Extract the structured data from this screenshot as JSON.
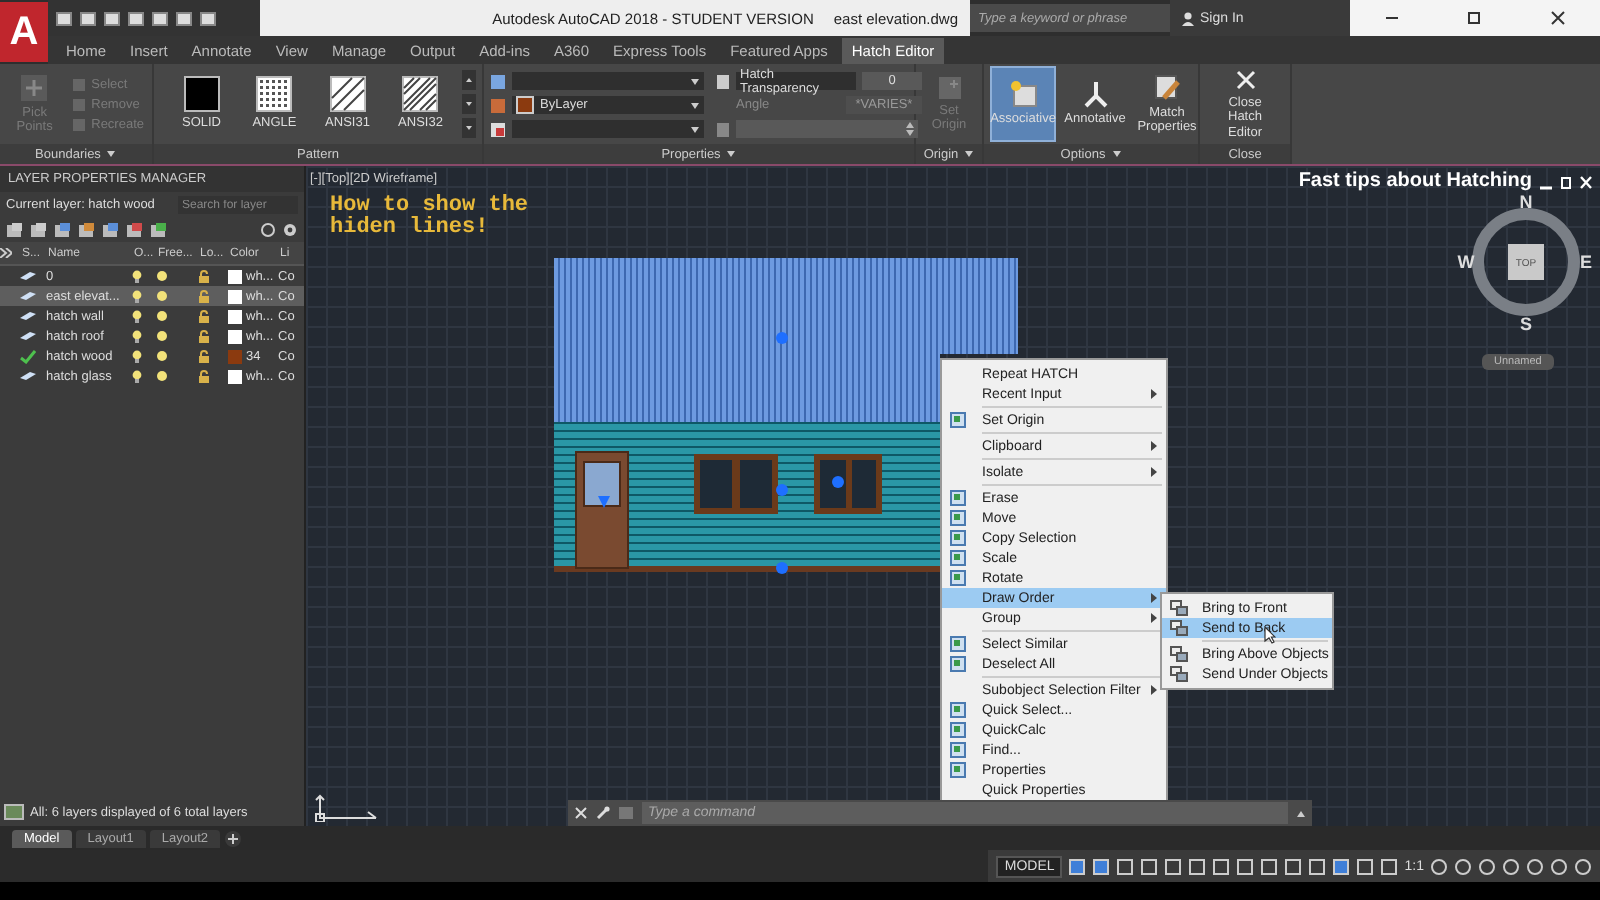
{
  "app_button": {
    "label": "A"
  },
  "title_bar": {
    "title": "Autodesk AutoCAD 2018 - STUDENT VERSION",
    "file": "east elevation.dwg",
    "search": {
      "placeholder": "Type a keyword or phrase"
    },
    "sign_in": "Sign In"
  },
  "ribbon_tabs": [
    {
      "label": "Home",
      "selected": false
    },
    {
      "label": "Insert",
      "selected": false
    },
    {
      "label": "Annotate",
      "selected": false
    },
    {
      "label": "View",
      "selected": false
    },
    {
      "label": "Manage",
      "selected": false
    },
    {
      "label": "Output",
      "selected": false
    },
    {
      "label": "Add-ins",
      "selected": false
    },
    {
      "label": "A360",
      "selected": false
    },
    {
      "label": "Express Tools",
      "selected": false
    },
    {
      "label": "Featured Apps",
      "selected": false
    },
    {
      "label": "Hatch Editor",
      "selected": true
    }
  ],
  "ribbon": {
    "boundaries": {
      "title": "Boundaries",
      "menu": true,
      "buttons": [
        {
          "label": "Pick Points",
          "disabled": true
        },
        {
          "label": "Select",
          "disabled": true
        },
        {
          "label": "Remove",
          "disabled": true
        },
        {
          "label": "Recreate",
          "disabled": true
        }
      ]
    },
    "pattern": {
      "title": "Pattern",
      "menu": false,
      "swatches": [
        {
          "kind": "solid",
          "label": "SOLID"
        },
        {
          "kind": "angle",
          "label": "ANGLE"
        },
        {
          "kind": "ansi31",
          "label": "ANSI31"
        },
        {
          "kind": "ansi32",
          "label": "ANSI32"
        }
      ]
    },
    "properties": {
      "title": "Properties",
      "menu": true,
      "hatch_color": "ByLayer",
      "transparency": {
        "label": "Hatch Transparency",
        "value": "0"
      },
      "angle": {
        "label": "Angle",
        "value": "*VARIES*"
      }
    },
    "origin": {
      "title": "Origin",
      "menu": true,
      "buttons": [
        {
          "label": "Set Origin",
          "disabled": true
        }
      ]
    },
    "options": {
      "title": "Options",
      "menu": true,
      "buttons": [
        {
          "label": "Associative",
          "selected": true
        },
        {
          "label": "Annotative",
          "selected": false
        },
        {
          "label": "Match Properties",
          "selected": false
        }
      ]
    },
    "close": {
      "title": "Close",
      "menu": false,
      "buttons": [
        {
          "label": "Close Hatch Editor"
        }
      ]
    }
  },
  "layer_panel": {
    "title": "LAYER PROPERTIES MANAGER",
    "current_layer": "Current layer: hatch wood",
    "search": {
      "placeholder": "Search for layer"
    },
    "columns": [
      "S...",
      "Name",
      "O...",
      "Free...",
      "Lo...",
      "Color",
      "Li"
    ],
    "layers": [
      {
        "name": "0",
        "current": false,
        "selected": false,
        "color": "#ffffff",
        "color_name": "wh...",
        "linetype": "Co"
      },
      {
        "name": "east elevat...",
        "current": false,
        "selected": true,
        "color": "#ffffff",
        "color_name": "wh...",
        "linetype": "Co"
      },
      {
        "name": "hatch wall",
        "current": false,
        "selected": false,
        "color": "#ffffff",
        "color_name": "wh...",
        "linetype": "Co"
      },
      {
        "name": "hatch roof",
        "current": false,
        "selected": false,
        "color": "#ffffff",
        "color_name": "wh...",
        "linetype": "Co"
      },
      {
        "name": "hatch wood",
        "current": true,
        "selected": false,
        "color": "#8b3a0f",
        "color_name": "34",
        "linetype": "Co"
      },
      {
        "name": "hatch glass",
        "current": false,
        "selected": false,
        "color": "#ffffff",
        "color_name": "wh...",
        "linetype": "Co"
      }
    ],
    "status": "All: 6 layers displayed of 6 total layers"
  },
  "viewport": {
    "label": "[-][Top][2D Wireframe]",
    "annotation": [
      "How to show the",
      "hiden lines!"
    ],
    "tip_title": "Fast tips about Hatching"
  },
  "view_cube": {
    "top": "TOP",
    "north": "N",
    "south": "S",
    "east": "E",
    "west": "W",
    "ucs": "Unnamed"
  },
  "context_menu": {
    "groups": [
      [
        {
          "label": "Repeat HATCH",
          "icon": false,
          "arrow": false,
          "selected": false
        },
        {
          "label": "Recent Input",
          "icon": false,
          "arrow": true,
          "selected": false
        }
      ],
      [
        {
          "label": "Set Origin",
          "icon": true,
          "arrow": false,
          "selected": false
        }
      ],
      [
        {
          "label": "Clipboard",
          "icon": false,
          "arrow": true,
          "selected": false
        }
      ],
      [
        {
          "label": "Isolate",
          "icon": false,
          "arrow": true,
          "selected": false
        }
      ],
      [
        {
          "label": "Erase",
          "icon": true,
          "arrow": false,
          "selected": false
        },
        {
          "label": "Move",
          "icon": true,
          "arrow": false,
          "selected": false
        },
        {
          "label": "Copy Selection",
          "icon": true,
          "arrow": false,
          "selected": false
        },
        {
          "label": "Scale",
          "icon": true,
          "arrow": false,
          "selected": false
        },
        {
          "label": "Rotate",
          "icon": true,
          "arrow": false,
          "selected": false
        },
        {
          "label": "Draw Order",
          "icon": false,
          "arrow": true,
          "selected": true
        },
        {
          "label": "Group",
          "icon": false,
          "arrow": true,
          "selected": false
        }
      ],
      [
        {
          "label": "Select Similar",
          "icon": true,
          "arrow": false,
          "selected": false
        },
        {
          "label": "Deselect All",
          "icon": true,
          "arrow": false,
          "selected": false
        }
      ],
      [
        {
          "label": "Subobject Selection Filter",
          "icon": false,
          "arrow": true,
          "selected": false
        },
        {
          "label": "Quick Select...",
          "icon": true,
          "arrow": false,
          "selected": false
        },
        {
          "label": "QuickCalc",
          "icon": true,
          "arrow": false,
          "selected": false
        },
        {
          "label": "Find...",
          "icon": true,
          "arrow": false,
          "selected": false
        },
        {
          "label": "Properties",
          "icon": true,
          "arrow": false,
          "selected": false
        },
        {
          "label": "Quick Properties",
          "icon": false,
          "arrow": false,
          "selected": false
        }
      ]
    ],
    "submenu": {
      "groups": [
        [
          {
            "label": "Bring to Front",
            "selected": false
          },
          {
            "label": "Send to Back",
            "selected": true
          }
        ],
        [
          {
            "label": "Bring Above Objects",
            "selected": false
          },
          {
            "label": "Send Under Objects",
            "selected": false
          }
        ]
      ]
    }
  },
  "command_line": {
    "placeholder": "Type a command"
  },
  "layout_tabs": [
    {
      "label": "Model",
      "selected": true
    },
    {
      "label": "Layout1",
      "selected": false
    },
    {
      "label": "Layout2",
      "selected": false
    }
  ],
  "status_bar": {
    "model": "MODEL",
    "scale": "1:1"
  }
}
